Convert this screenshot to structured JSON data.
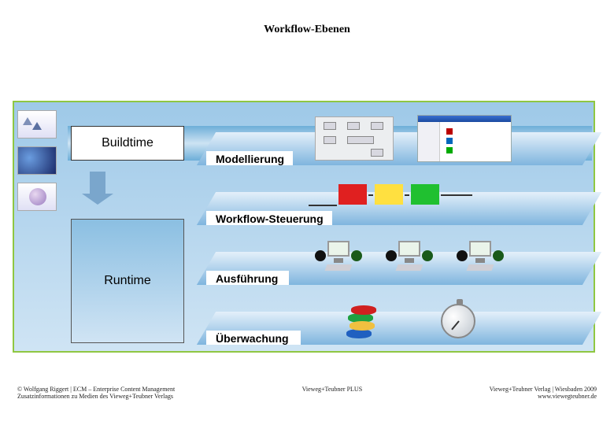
{
  "title": "Workflow-Ebenen",
  "phases": {
    "buildtime": "Buildtime",
    "runtime": "Runtime"
  },
  "layers": {
    "modeling": "Modellierung",
    "control": "Workflow-Steuerung",
    "execution": "Ausführung",
    "monitoring": "Überwachung"
  },
  "footer": {
    "left_line1": "© Wolfgang Riggert | ECM – Enterprise Content Management",
    "left_line2": "Zusatzinformationen zu Medien des Vieweg+Teubner Verlags",
    "center": "Vieweg+Teubner PLUS",
    "right_line1": "Vieweg+Teubner Verlag | Wiesbaden 2009",
    "right_line2": "www.viewegteubner.de"
  },
  "colors": {
    "frame_border": "#8fc742",
    "gradient_top": "#9ec9e8",
    "gradient_bottom": "#cfe4f4",
    "status_red": "#e02020",
    "status_yellow": "#ffe040",
    "status_green": "#20c030"
  }
}
